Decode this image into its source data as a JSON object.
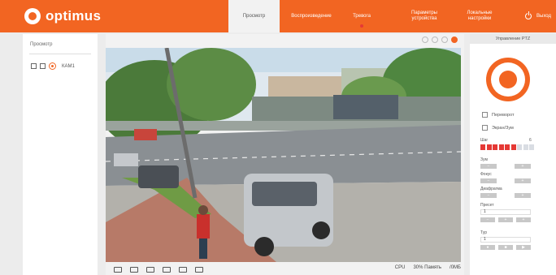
{
  "brand": {
    "name": "optimus"
  },
  "nav": {
    "tabs": [
      {
        "label": "Просмотр",
        "active": true
      },
      {
        "label": "Воспроизведение",
        "active": false
      },
      {
        "label": "Тревога",
        "active": false
      },
      {
        "label": "Параметры устройства",
        "active": false
      },
      {
        "label": "Локальные настройки",
        "active": false
      }
    ],
    "logout": "Выход"
  },
  "left_panel": {
    "title": "Просмотр",
    "camera_label": "КАМ1"
  },
  "player_status": {
    "cpu": "CPU",
    "memory": "30% Память",
    "bitrate": "/0МБ"
  },
  "ptz": {
    "title": "Управление PTZ",
    "flip_label": "Переворот",
    "zoom_label": "Экран/Зум",
    "speed_label": "Шаг",
    "speed_value": "6",
    "speed_level": 6,
    "speed_max": 9,
    "zoom_ctrl_label": "Зум",
    "focus_label": "Фокус",
    "iris_label": "Диафрагма",
    "preset_label": "Пресет",
    "preset_value": "1",
    "tour_label": "Тур",
    "tour_value": "1"
  },
  "colors": {
    "accent": "#f26522",
    "speed_on": "#e53935",
    "speed_off": "#d9dde3"
  }
}
